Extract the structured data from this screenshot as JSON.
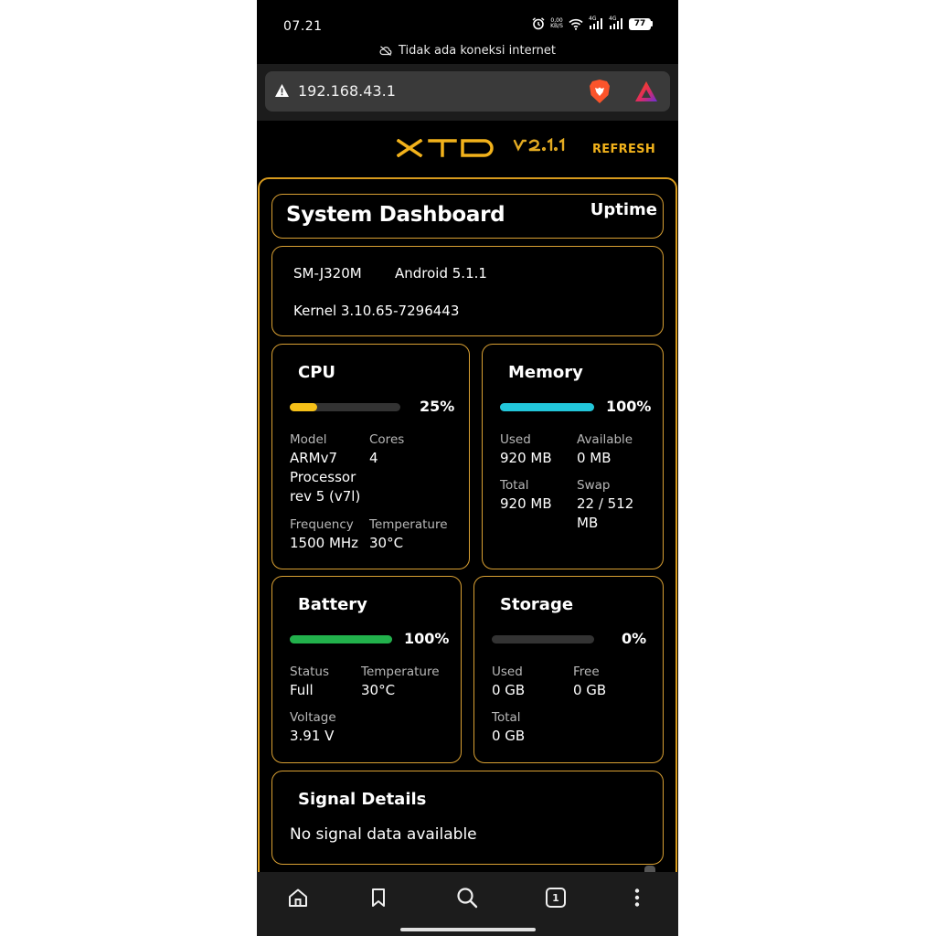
{
  "status_bar": {
    "time": "07.21",
    "speed_value": "0,00",
    "speed_unit": "KB/S",
    "net1": "4G",
    "net2": "4G",
    "battery_level": "77",
    "offline_message": "Tidak ada koneksi internet"
  },
  "browser": {
    "url": "192.168.43.1",
    "warning_icon": "warning-triangle-icon",
    "shield_icon": "brave-shield-icon",
    "rewards_icon": "brave-rewards-icon"
  },
  "header": {
    "brand": "XTD",
    "version": "v2.1.1",
    "refresh_label": "REFRESH"
  },
  "dashboard": {
    "title": "System Dashboard",
    "uptime_label": "Uptime",
    "device": {
      "model": "SM-J320M",
      "android": "Android 5.1.1",
      "kernel": "Kernel 3.10.65-7296443"
    },
    "cpu": {
      "title": "CPU",
      "usage_percent": 25,
      "usage_label": "25%",
      "bar_color": "#f5c018",
      "model_label": "Model",
      "model_value": [
        "ARMv7",
        "Processor",
        "rev 5 (v7l)"
      ],
      "cores_label": "Cores",
      "cores_value": "4",
      "frequency_label": "Frequency",
      "frequency_value": "1500 MHz",
      "temperature_label": "Temperature",
      "temperature_value": "30°C"
    },
    "memory": {
      "title": "Memory",
      "usage_percent": 100,
      "usage_label": "100%",
      "bar_color": "#22c6da",
      "used_label": "Used",
      "used_value": "920 MB",
      "available_label": "Available",
      "available_value": "0 MB",
      "total_label": "Total",
      "total_value": "920 MB",
      "swap_label": "Swap",
      "swap_value": [
        "22 / 512",
        "MB"
      ]
    },
    "battery": {
      "title": "Battery",
      "level_percent": 100,
      "level_label": "100%",
      "bar_color": "#22b14c",
      "status_label": "Status",
      "status_value": "Full",
      "temperature_label": "Temperature",
      "temperature_value": "30°C",
      "voltage_label": "Voltage",
      "voltage_value": "3.91 V"
    },
    "storage": {
      "title": "Storage",
      "usage_percent": 0,
      "usage_label": "0%",
      "bar_color": "#9e9e9e",
      "used_label": "Used",
      "used_value": "0 GB",
      "free_label": "Free",
      "free_value": "0 GB",
      "total_label": "Total",
      "total_value": "0 GB"
    },
    "signal": {
      "title": "Signal Details",
      "message": "No signal data available"
    }
  },
  "bottom_nav": {
    "tab_count": "1",
    "items": [
      "home-icon",
      "bookmark-icon",
      "search-icon",
      "tabs-icon",
      "more-icon"
    ]
  },
  "colors": {
    "accent": "#d9a033",
    "brand": "#f2b21b"
  }
}
